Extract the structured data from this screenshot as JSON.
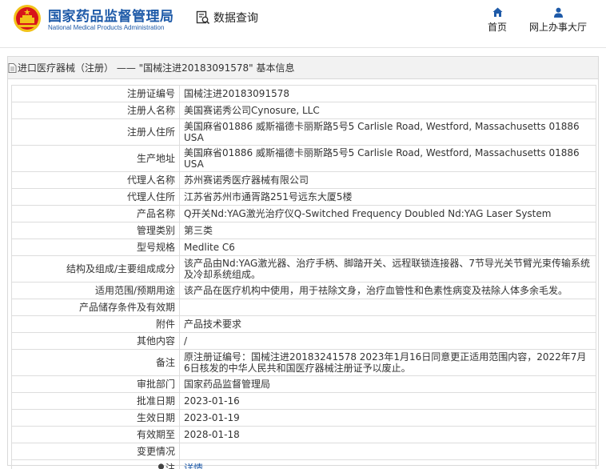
{
  "header": {
    "brand_cn": "国家药品监督管理局",
    "brand_en": "National Medical Products Administration",
    "query_label": "数据查询",
    "nav": [
      {
        "label": "首页",
        "icon": "home-icon"
      },
      {
        "label": "网上办事大厅",
        "icon": "user-icon"
      }
    ],
    "colors": {
      "brand": "#1e5aa8",
      "emblem_red": "#d7141a",
      "emblem_gold": "#f2c21a"
    }
  },
  "panel": {
    "title": "进口医疗器械（注册） —— \"国械注进20183091578\" 基本信息"
  },
  "rows": [
    {
      "label": "注册证编号",
      "value": "国械注进20183091578"
    },
    {
      "label": "注册人名称",
      "value": "美国赛诺秀公司Cynosure, LLC"
    },
    {
      "label": "注册人住所",
      "value": "美国麻省01886 威斯福德卡丽斯路5号5 Carlisle Road, Westford, Massachusetts 01886 USA"
    },
    {
      "label": "生产地址",
      "value": "美国麻省01886 威斯福德卡丽斯路5号5 Carlisle Road, Westford, Massachusetts 01886 USA"
    },
    {
      "label": "代理人名称",
      "value": "苏州赛诺秀医疗器械有限公司"
    },
    {
      "label": "代理人住所",
      "value": "江苏省苏州市通胥路251号远东大厦5楼"
    },
    {
      "label": "产品名称",
      "value": "Q开关Nd:YAG激光治疗仪Q-Switched Frequency Doubled Nd:YAG Laser System"
    },
    {
      "label": "管理类别",
      "value": "第三类"
    },
    {
      "label": "型号规格",
      "value": "Medlite C6"
    },
    {
      "label": "结构及组成/主要组成成分",
      "value": "该产品由Nd:YAG激光器、治疗手柄、脚踏开关、远程联锁连接器、7节导光关节臂光束传输系统及冷却系统组成。"
    },
    {
      "label": "适用范围/预期用途",
      "value": "该产品在医疗机构中使用，用于祛除文身，治疗血管性和色素性病变及祛除人体多余毛发。"
    },
    {
      "label": "产品储存条件及有效期",
      "value": ""
    },
    {
      "label": "附件",
      "value": "产品技术要求"
    },
    {
      "label": "其他内容",
      "value": "/"
    },
    {
      "label": "备注",
      "value": "原注册证编号：国械注进20183241578 2023年1月16日同意更正适用范围内容，2022年7月6日核发的中华人民共和国医疗器械注册证予以废止。"
    },
    {
      "label": "审批部门",
      "value": "国家药品监督管理局"
    },
    {
      "label": "批准日期",
      "value": "2023-01-16"
    },
    {
      "label": "生效日期",
      "value": "2023-01-19"
    },
    {
      "label": "有效期至",
      "value": "2028-01-18"
    },
    {
      "label": "变更情况",
      "value": ""
    },
    {
      "label": "注",
      "value": "详情"
    }
  ]
}
